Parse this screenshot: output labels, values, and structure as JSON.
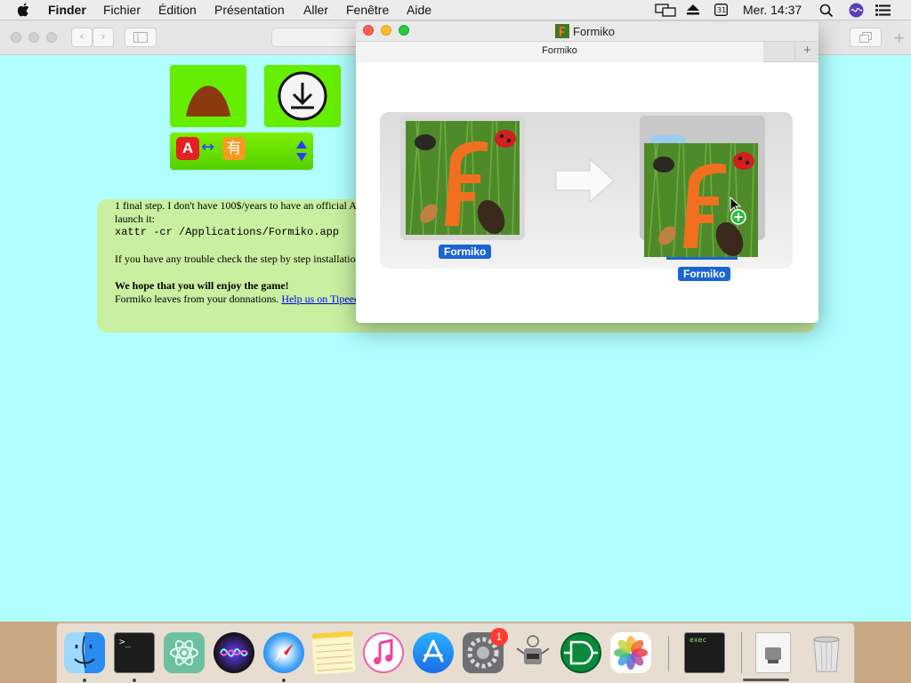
{
  "menubar": {
    "app_name": "Finder",
    "items": [
      "Fichier",
      "Édition",
      "Présentation",
      "Aller",
      "Fenêtre",
      "Aide"
    ],
    "clock": "Mer. 14:37"
  },
  "webpage": {
    "line1": "1 final step. I don't have 100$/years to have an official A",
    "line2": "launch it:",
    "command": "xattr -cr /Applications/Formiko.app",
    "line3": "If you have any trouble check the step by step installatio",
    "line4_bold": "We hope that you will enjoy the game!",
    "line5": "Formiko leaves from your donnations. ",
    "link": "Help us on Tipeee",
    "language_glyph_a": "A",
    "language_glyph_b": "有",
    "language_arrow": "↔"
  },
  "finder_window": {
    "title": "Formiko",
    "tab_label": "Formiko",
    "tab_add": "+",
    "source_label": "Formiko",
    "target_label": "Formiko"
  },
  "dock": {
    "terminal_prompt": ">_",
    "exec_label": "exec",
    "prefs_badge": "1",
    "icons": [
      "finder-icon",
      "terminal-icon",
      "atom-icon",
      "siri-icon",
      "safari-icon",
      "notes-icon",
      "itunes-icon",
      "app-store-icon",
      "system-preferences-icon",
      "automator-icon",
      "logisim-icon",
      "photos-icon",
      "exec-terminal-icon",
      "document-icon",
      "trash-icon"
    ]
  },
  "colors": {
    "page_background": "#b0feff",
    "tile_green": "#66ee00",
    "card_green": "#c8f0a0",
    "selection_blue": "#1a64d4",
    "anthill_brown": "#8b3a0f",
    "formiko_orange": "#f07020"
  }
}
